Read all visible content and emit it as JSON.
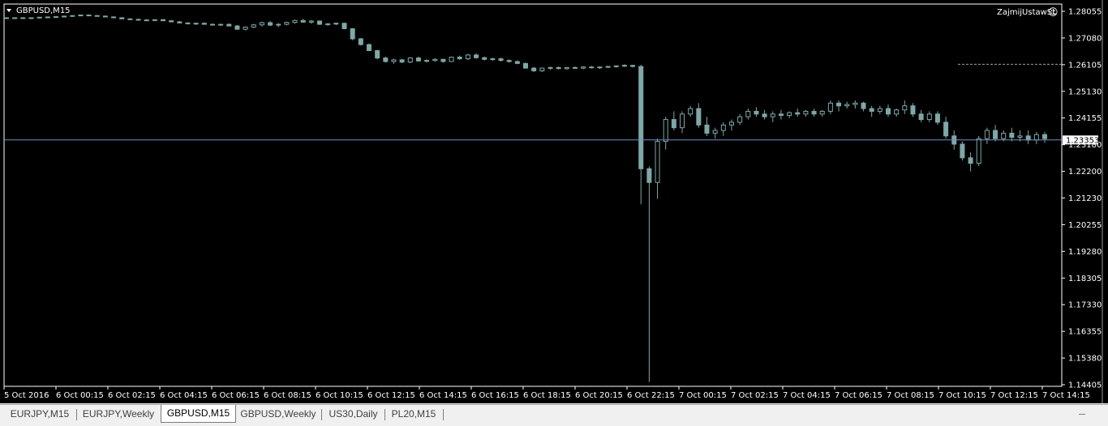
{
  "chart": {
    "symbol_label": "GBPUSD,M15",
    "expert_label": "ZajmijUstawSL",
    "smiley_icon": "☺",
    "current_price": "1.23353",
    "background_color": "#000000",
    "candle_color": "#7fa7a7",
    "bull_color": "#00c000",
    "price_line_color": "#6d8fc6",
    "level_line_color": "#a0a0a0"
  },
  "chart_data": {
    "type": "candlestick",
    "ylim": [
      1.14405,
      1.28055
    ],
    "y_ticks": [
      "1.28055",
      "1.27080",
      "1.26105",
      "1.25130",
      "1.24155",
      "1.23180",
      "1.22200",
      "1.21230",
      "1.20255",
      "1.19280",
      "1.18305",
      "1.17330",
      "1.16355",
      "1.15380",
      "1.14405"
    ],
    "x_ticks": [
      "5 Oct 2016",
      "6 Oct 00:15",
      "6 Oct 02:15",
      "6 Oct 04:15",
      "6 Oct 06:15",
      "6 Oct 08:15",
      "6 Oct 10:15",
      "6 Oct 12:15",
      "6 Oct 14:15",
      "6 Oct 16:15",
      "6 Oct 18:15",
      "6 Oct 20:15",
      "6 Oct 22:15",
      "7 Oct 00:15",
      "7 Oct 02:15",
      "7 Oct 04:15",
      "7 Oct 06:15",
      "7 Oct 08:15",
      "7 Oct 10:15",
      "7 Oct 12:15",
      "7 Oct 14:15"
    ],
    "horizontal_level": 1.2612,
    "ohlc": [
      [
        1.2782,
        1.2784,
        1.2779,
        1.278
      ],
      [
        1.2781,
        1.2783,
        1.2779,
        1.2782
      ],
      [
        1.2782,
        1.2784,
        1.278,
        1.2781
      ],
      [
        1.2781,
        1.2783,
        1.2779,
        1.2782
      ],
      [
        1.2782,
        1.2785,
        1.278,
        1.2784
      ],
      [
        1.2784,
        1.2786,
        1.2782,
        1.2785
      ],
      [
        1.2785,
        1.2787,
        1.2783,
        1.2786
      ],
      [
        1.2786,
        1.2789,
        1.2784,
        1.2788
      ],
      [
        1.2788,
        1.2791,
        1.2786,
        1.279
      ],
      [
        1.279,
        1.2793,
        1.2788,
        1.2792
      ],
      [
        1.2792,
        1.2794,
        1.2789,
        1.279
      ],
      [
        1.279,
        1.2792,
        1.2787,
        1.2788
      ],
      [
        1.2788,
        1.279,
        1.2784,
        1.2785
      ],
      [
        1.2785,
        1.2787,
        1.278,
        1.2782
      ],
      [
        1.2782,
        1.2784,
        1.2777,
        1.2778
      ],
      [
        1.2778,
        1.278,
        1.2774,
        1.2776
      ],
      [
        1.2776,
        1.2779,
        1.2772,
        1.2774
      ],
      [
        1.2774,
        1.2777,
        1.277,
        1.2772
      ],
      [
        1.2772,
        1.2776,
        1.2769,
        1.2775
      ],
      [
        1.2775,
        1.2778,
        1.277,
        1.2771
      ],
      [
        1.2771,
        1.2774,
        1.2766,
        1.2767
      ],
      [
        1.2767,
        1.277,
        1.2762,
        1.2763
      ],
      [
        1.2763,
        1.2766,
        1.2758,
        1.276
      ],
      [
        1.276,
        1.2764,
        1.2756,
        1.2762
      ],
      [
        1.2762,
        1.2765,
        1.2757,
        1.2758
      ],
      [
        1.2758,
        1.2761,
        1.2754,
        1.2756
      ],
      [
        1.2756,
        1.276,
        1.2752,
        1.2758
      ],
      [
        1.2758,
        1.2761,
        1.2751,
        1.2752
      ],
      [
        1.2752,
        1.2755,
        1.2738,
        1.274
      ],
      [
        1.274,
        1.275,
        1.2736,
        1.2748
      ],
      [
        1.2748,
        1.276,
        1.2744,
        1.2756
      ],
      [
        1.2756,
        1.2768,
        1.275,
        1.2764
      ],
      [
        1.2764,
        1.277,
        1.2752,
        1.2755
      ],
      [
        1.2755,
        1.2762,
        1.2748,
        1.2758
      ],
      [
        1.2758,
        1.2768,
        1.2754,
        1.2765
      ],
      [
        1.2765,
        1.2775,
        1.276,
        1.2772
      ],
      [
        1.2772,
        1.2778,
        1.2764,
        1.2766
      ],
      [
        1.2766,
        1.2774,
        1.276,
        1.277
      ],
      [
        1.277,
        1.2772,
        1.2756,
        1.2758
      ],
      [
        1.2758,
        1.2762,
        1.2752,
        1.276
      ],
      [
        1.276,
        1.2764,
        1.2755,
        1.2762
      ],
      [
        1.2762,
        1.2764,
        1.274,
        1.2742
      ],
      [
        1.2742,
        1.2744,
        1.27,
        1.2705
      ],
      [
        1.2705,
        1.2708,
        1.268,
        1.2684
      ],
      [
        1.2684,
        1.2688,
        1.266,
        1.2662
      ],
      [
        1.2662,
        1.2665,
        1.263,
        1.2635
      ],
      [
        1.2635,
        1.264,
        1.2618,
        1.2622
      ],
      [
        1.2622,
        1.2632,
        1.2614,
        1.2628
      ],
      [
        1.2628,
        1.2632,
        1.2616,
        1.262
      ],
      [
        1.262,
        1.2638,
        1.2616,
        1.2635
      ],
      [
        1.2635,
        1.264,
        1.2622,
        1.2624
      ],
      [
        1.2624,
        1.263,
        1.2618,
        1.2626
      ],
      [
        1.2626,
        1.2634,
        1.262,
        1.263
      ],
      [
        1.263,
        1.2632,
        1.2618,
        1.2622
      ],
      [
        1.2622,
        1.264,
        1.262,
        1.2638
      ],
      [
        1.2638,
        1.2644,
        1.2628,
        1.2632
      ],
      [
        1.2632,
        1.265,
        1.2628,
        1.2646
      ],
      [
        1.2646,
        1.2652,
        1.2632,
        1.2636
      ],
      [
        1.2636,
        1.264,
        1.2626,
        1.263
      ],
      [
        1.263,
        1.2636,
        1.2624,
        1.2632
      ],
      [
        1.2632,
        1.2636,
        1.2622,
        1.2626
      ],
      [
        1.2626,
        1.263,
        1.2618,
        1.2622
      ],
      [
        1.2622,
        1.2626,
        1.2612,
        1.2615
      ],
      [
        1.2615,
        1.2618,
        1.2596,
        1.2598
      ],
      [
        1.2598,
        1.2602,
        1.2584,
        1.2588
      ],
      [
        1.2588,
        1.26,
        1.2584,
        1.2598
      ],
      [
        1.2598,
        1.2603,
        1.2592,
        1.26
      ],
      [
        1.26,
        1.2604,
        1.2594,
        1.2596
      ],
      [
        1.2596,
        1.2602,
        1.2592,
        1.26
      ],
      [
        1.26,
        1.2604,
        1.2596,
        1.2598
      ],
      [
        1.2598,
        1.2604,
        1.2594,
        1.2602
      ],
      [
        1.2602,
        1.2606,
        1.2596,
        1.26
      ],
      [
        1.26,
        1.2604,
        1.2595,
        1.2602
      ],
      [
        1.2602,
        1.2606,
        1.2598,
        1.2604
      ],
      [
        1.2604,
        1.2608,
        1.26,
        1.2606
      ],
      [
        1.2606,
        1.2612,
        1.2602,
        1.2608
      ],
      [
        1.2608,
        1.261,
        1.26,
        1.2604
      ],
      [
        1.2604,
        1.261,
        1.21,
        1.223
      ],
      [
        1.223,
        1.2238,
        1.145,
        1.218
      ],
      [
        1.218,
        1.234,
        1.212,
        1.233
      ],
      [
        1.233,
        1.242,
        1.23,
        1.241
      ],
      [
        1.241,
        1.244,
        1.237,
        1.238
      ],
      [
        1.238,
        1.244,
        1.236,
        1.243
      ],
      [
        1.243,
        1.246,
        1.242,
        1.245
      ],
      [
        1.245,
        1.247,
        1.238,
        1.239
      ],
      [
        1.239,
        1.242,
        1.235,
        1.236
      ],
      [
        1.236,
        1.238,
        1.234,
        1.237
      ],
      [
        1.237,
        1.24,
        1.235,
        1.239
      ],
      [
        1.239,
        1.241,
        1.237,
        1.24
      ],
      [
        1.24,
        1.243,
        1.239,
        1.242
      ],
      [
        1.242,
        1.245,
        1.241,
        1.244
      ],
      [
        1.244,
        1.2455,
        1.242,
        1.243
      ],
      [
        1.243,
        1.2445,
        1.241,
        1.242
      ],
      [
        1.242,
        1.244,
        1.24,
        1.243
      ],
      [
        1.243,
        1.2445,
        1.241,
        1.2425
      ],
      [
        1.2425,
        1.244,
        1.2415,
        1.2435
      ],
      [
        1.2435,
        1.245,
        1.242,
        1.243
      ],
      [
        1.243,
        1.2445,
        1.242,
        1.244
      ],
      [
        1.244,
        1.245,
        1.242,
        1.243
      ],
      [
        1.243,
        1.2445,
        1.242,
        1.244
      ],
      [
        1.244,
        1.248,
        1.243,
        1.247
      ],
      [
        1.247,
        1.248,
        1.244,
        1.246
      ],
      [
        1.246,
        1.2475,
        1.245,
        1.2465
      ],
      [
        1.2465,
        1.248,
        1.245,
        1.247
      ],
      [
        1.247,
        1.2475,
        1.244,
        1.245
      ],
      [
        1.245,
        1.246,
        1.242,
        1.244
      ],
      [
        1.244,
        1.246,
        1.243,
        1.245
      ],
      [
        1.245,
        1.2465,
        1.242,
        1.243
      ],
      [
        1.243,
        1.245,
        1.242,
        1.2445
      ],
      [
        1.2445,
        1.248,
        1.243,
        1.246
      ],
      [
        1.246,
        1.247,
        1.242,
        1.243
      ],
      [
        1.243,
        1.2445,
        1.24,
        1.241
      ],
      [
        1.241,
        1.244,
        1.24,
        1.243
      ],
      [
        1.243,
        1.244,
        1.239,
        1.24
      ],
      [
        1.24,
        1.242,
        1.234,
        1.235
      ],
      [
        1.235,
        1.237,
        1.23,
        1.232
      ],
      [
        1.232,
        1.233,
        1.226,
        1.227
      ],
      [
        1.227,
        1.229,
        1.222,
        1.225
      ],
      [
        1.225,
        1.235,
        1.224,
        1.234
      ],
      [
        1.234,
        1.238,
        1.232,
        1.237
      ],
      [
        1.237,
        1.239,
        1.233,
        1.234
      ],
      [
        1.234,
        1.237,
        1.233,
        1.236
      ],
      [
        1.236,
        1.238,
        1.233,
        1.2345
      ],
      [
        1.2345,
        1.237,
        1.233,
        1.235
      ],
      [
        1.235,
        1.237,
        1.232,
        1.2335
      ],
      [
        1.2335,
        1.2365,
        1.232,
        1.2355
      ],
      [
        1.2355,
        1.2365,
        1.2325,
        1.234
      ]
    ]
  },
  "tabs": [
    {
      "label": "EURJPY,M15"
    },
    {
      "label": "EURJPY,Weekly"
    },
    {
      "label": "GBPUSD,M15"
    },
    {
      "label": "GBPUSD,Weekly"
    },
    {
      "label": "US30,Daily"
    },
    {
      "label": "PL20,M15"
    }
  ]
}
